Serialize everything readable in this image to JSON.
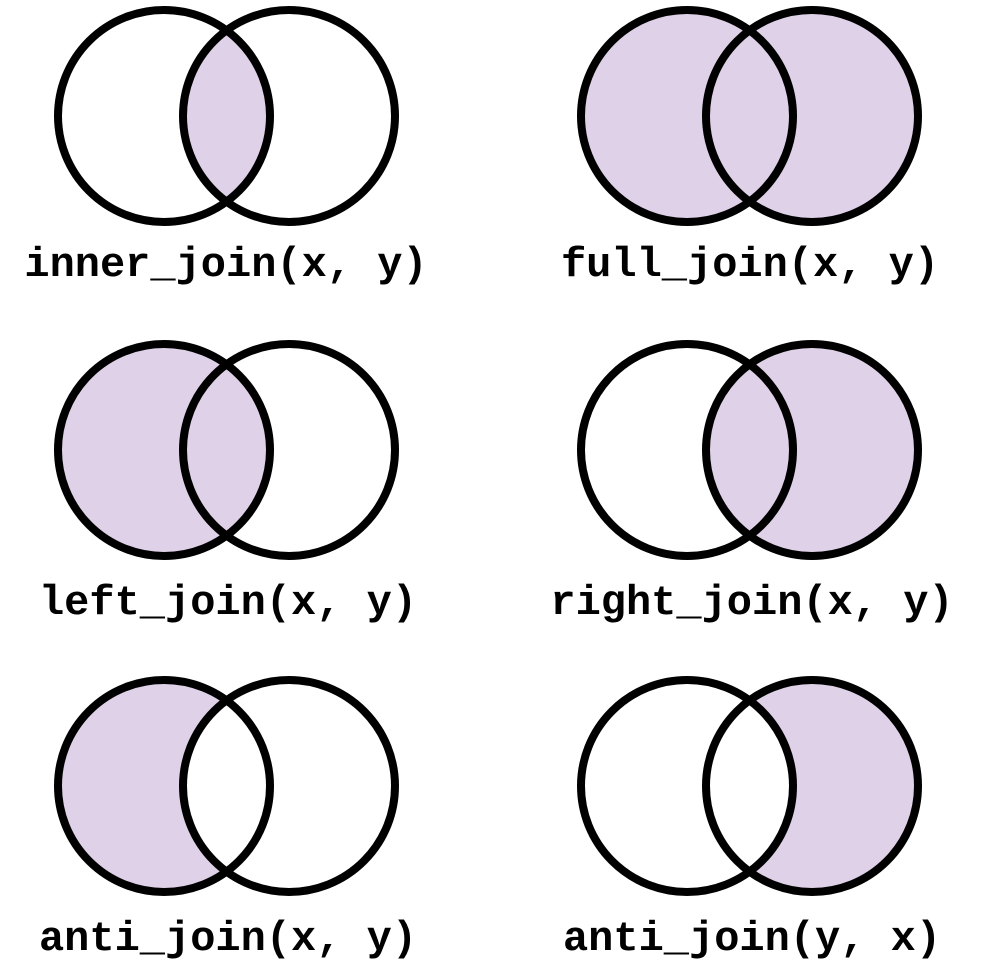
{
  "colors": {
    "fill": "#dfd1e7",
    "stroke": "#000000",
    "background": "#ffffff"
  },
  "panels": [
    {
      "id": "inner",
      "label": "inner_join(x, y)",
      "highlight": "intersection"
    },
    {
      "id": "full",
      "label": "full_join(x, y)",
      "highlight": "union"
    },
    {
      "id": "left",
      "label": "left_join(x, y)",
      "highlight": "left"
    },
    {
      "id": "right",
      "label": "right_join(x, y)",
      "highlight": "right"
    },
    {
      "id": "anti-xy",
      "label": "anti_join(x, y)",
      "highlight": "left-only"
    },
    {
      "id": "anti-yx",
      "label": "anti_join(y, x)",
      "highlight": "right-only"
    }
  ]
}
